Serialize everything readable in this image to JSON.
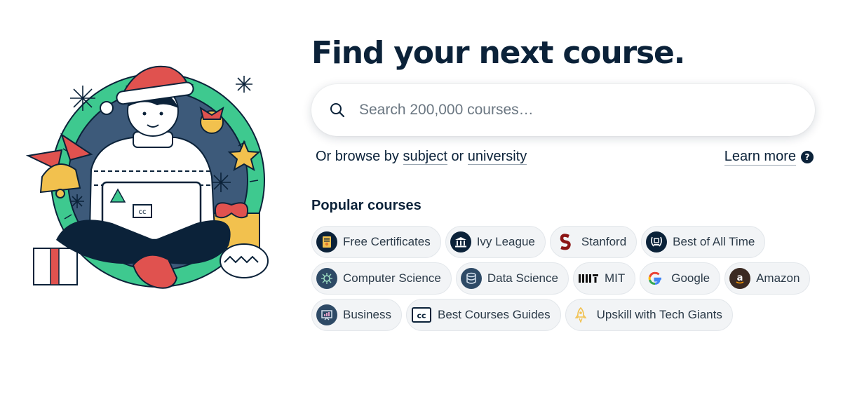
{
  "hero": {
    "title": "Find your next course."
  },
  "search": {
    "placeholder": "Search 200,000 courses…",
    "value": ""
  },
  "browse": {
    "prefix": "Or browse by",
    "subject_link": "subject",
    "connector": "or",
    "university_link": "university",
    "learn_more": "Learn more",
    "help_glyph": "?"
  },
  "popular": {
    "heading": "Popular courses",
    "rows": [
      [
        {
          "label": "Free Certificates",
          "icon": "certificate-icon"
        },
        {
          "label": "Ivy League",
          "icon": "university-building-icon"
        },
        {
          "label": "Stanford",
          "icon": "stanford-logo-icon"
        },
        {
          "label": "Best of All Time",
          "icon": "award-laurel-icon"
        }
      ],
      [
        {
          "label": "Computer Science",
          "icon": "circuit-icon"
        },
        {
          "label": "Data Science",
          "icon": "database-icon"
        },
        {
          "label": "MIT",
          "icon": "mit-logo-icon"
        },
        {
          "label": "Google",
          "icon": "google-logo-icon"
        },
        {
          "label": "Amazon",
          "icon": "amazon-logo-icon"
        }
      ],
      [
        {
          "label": "Business",
          "icon": "presentation-chart-icon"
        },
        {
          "label": "Best Courses Guides",
          "icon": "cc-logo-icon"
        },
        {
          "label": "Upskill with Tech Giants",
          "icon": "rocket-icon"
        }
      ]
    ]
  },
  "colors": {
    "navy": "#0b2239",
    "chip_bg": "#f2f4f6",
    "stanford_red": "#8c1515",
    "illustration_blue": "#3d5a7a",
    "wreath_green": "#3ec98f",
    "santa_red": "#e0524f"
  }
}
